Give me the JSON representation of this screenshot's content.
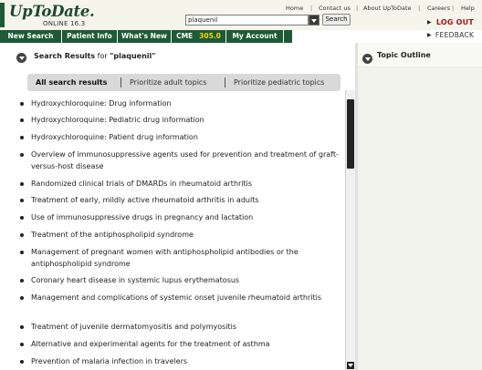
{
  "app": {
    "logo": "UpToDate.",
    "version": "ONLINE 16.3"
  },
  "top_links": [
    "Home",
    "Contact us",
    "About UpToDate",
    "Careers",
    "Help"
  ],
  "search": {
    "value": "plaquenil",
    "button_label": "Search"
  },
  "account": {
    "logout_label": "LOG OUT",
    "feedback_label": "FEEDBACK"
  },
  "nav": {
    "new_search": "New Search",
    "patient_info": "Patient Info",
    "whats_new": "What's New",
    "cme": "CME",
    "cme_value": "305.0",
    "my_account": "My Account"
  },
  "results": {
    "title_prefix": "Search Results",
    "title_for": " for ",
    "query": "\"plaquenil\""
  },
  "filters": [
    "All search results",
    "Prioritize adult topics",
    "Prioritize pediatric topics"
  ],
  "outline": {
    "title": "Topic Outline"
  },
  "result_items": [
    "Hydroxychloroquine: Drug information",
    "Hydroxychloroquine: Pediatric drug information",
    "Hydroxychloroquine: Patient drug information",
    "Overview of immunosuppressive agents used for prevention and treatment of graft-versus-host disease",
    "Randomized clinical trials of DMARDs in rheumatoid arthritis",
    "Treatment of early, mildly active rheumatoid arthritis in adults",
    "Use of immunosuppressive drugs in pregnancy and lactation",
    "Treatment of the antiphospholipid syndrome",
    "Management of pregnant women with antiphospholipid antibodies or the antiphospholipid syndrome",
    "Coronary heart disease in systemic lupus erythematosus",
    "Management and complications of systemic onset juvenile rheumatoid arthritis",
    "Treatment of juvenile dermatomyositis and polymyositis",
    "Alternative and experimental agents for the treatment of asthma",
    "Prevention of malaria infection in travelers"
  ]
}
